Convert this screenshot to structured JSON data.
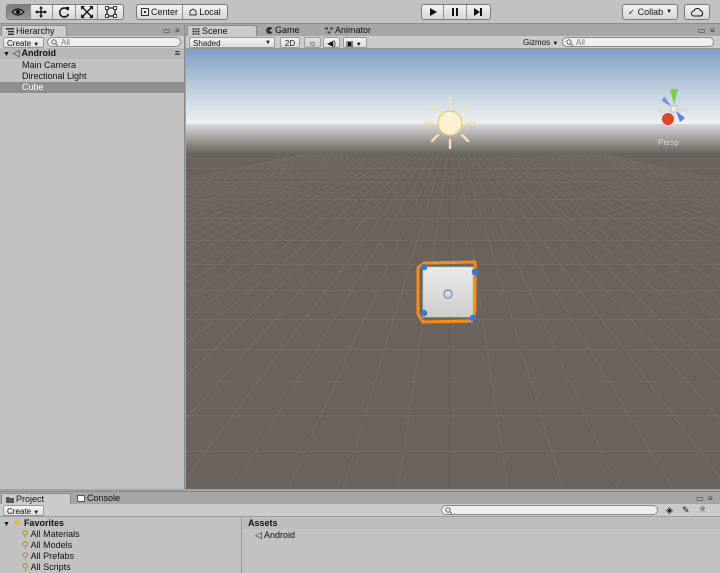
{
  "toolbar": {
    "tools": [
      {
        "name": "view-hand-tool",
        "icon": "eye-icon"
      },
      {
        "name": "move-tool",
        "icon": "move-arrows-icon"
      },
      {
        "name": "rotate-tool",
        "icon": "rotate-icon"
      },
      {
        "name": "scale-tool",
        "icon": "scale-icon"
      },
      {
        "name": "rect-tool",
        "icon": "rect-transform-icon"
      }
    ],
    "pivot_label": "Center",
    "space_label": "Local",
    "collab_label": "Collab",
    "cloud_icon": "cloud-icon",
    "play_icon": "play-icon",
    "pause_icon": "pause-icon",
    "step_icon": "step-icon"
  },
  "hierarchy": {
    "tab_label": "Hierarchy",
    "create_label": "Create",
    "search_placeholder": "All",
    "scene_name": "Android",
    "items": [
      "Main Camera",
      "Directional Light",
      "Cube"
    ],
    "selected": "Cube"
  },
  "scene_tabs": {
    "scene_label": "Scene",
    "game_label": "Game",
    "animator_label": "Animator"
  },
  "scene_toolbar": {
    "shading_mode": "Shaded",
    "toggle_2d": "2D",
    "gizmos_label": "Gizmos",
    "search_placeholder": "All"
  },
  "scene": {
    "gizmo_label": "Persp",
    "selected_object": "Cube",
    "colors": {
      "sky_top": "#7f9fc7",
      "horizon": "#eef1f4",
      "ground": "#6a625c",
      "grid": "#7f7873",
      "selection_outline": "#ff8a1a",
      "handle_blue": "#3c78d8"
    }
  },
  "project": {
    "tab_label": "Project",
    "console_label": "Console",
    "create_label": "Create",
    "favorites_label": "Favorites",
    "favorites": [
      "All Materials",
      "All Models",
      "All Prefabs",
      "All Scripts"
    ],
    "assets_header": "Assets",
    "assets": [
      "Android"
    ]
  }
}
